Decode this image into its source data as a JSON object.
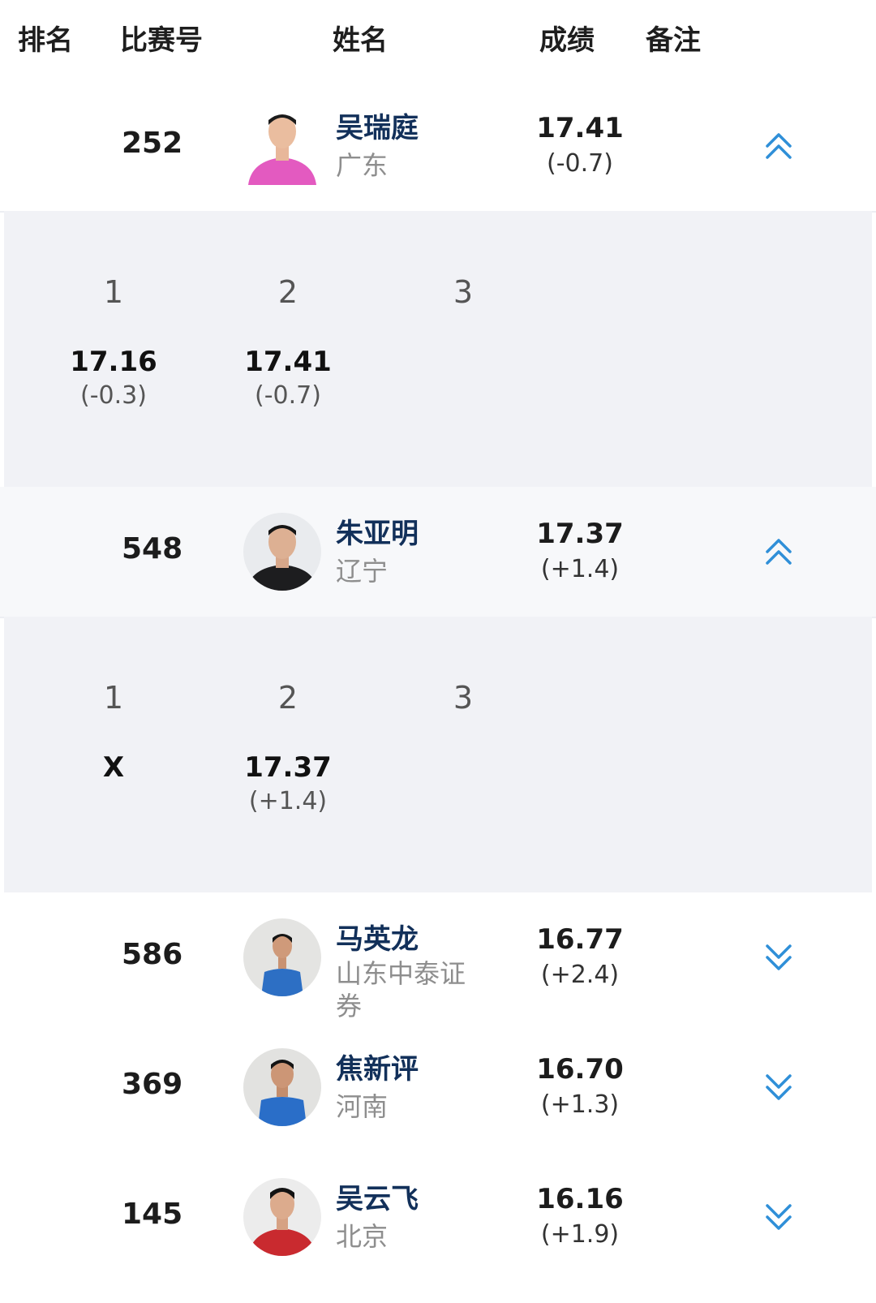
{
  "header": {
    "rank": "排名",
    "bib": "比赛号",
    "name": "姓名",
    "score": "成绩",
    "note": "备注"
  },
  "attempt_headers": [
    "1",
    "2",
    "3"
  ],
  "athletes": [
    {
      "bib": "252",
      "name": "吴瑞庭",
      "team": "广东",
      "score": "17.41",
      "wind": "(-0.7)",
      "expanded": true,
      "attempts": [
        {
          "value": "17.16",
          "wind": "(-0.3)"
        },
        {
          "value": "17.41",
          "wind": "(-0.7)"
        }
      ]
    },
    {
      "bib": "548",
      "name": "朱亚明",
      "team": "辽宁",
      "score": "17.37",
      "wind": "(+1.4)",
      "expanded": true,
      "attempts": [
        {
          "value": "X",
          "wind": ""
        },
        {
          "value": "17.37",
          "wind": "(+1.4)"
        }
      ]
    },
    {
      "bib": "586",
      "name": "马英龙",
      "team": "山东中泰证券",
      "score": "16.77",
      "wind": "(+2.4)",
      "expanded": false
    },
    {
      "bib": "369",
      "name": "焦新评",
      "team": "河南",
      "score": "16.70",
      "wind": "(+1.3)",
      "expanded": false
    },
    {
      "bib": "145",
      "name": "吴云飞",
      "team": "北京",
      "score": "16.16",
      "wind": "(+1.9)",
      "expanded": false
    }
  ],
  "icons": {
    "expanded": "chevron-double-up-icon",
    "collapsed": "chevron-double-down-icon"
  },
  "colors": {
    "accent": "#2f8fd8",
    "name": "#12305a",
    "panel": "#f1f2f6"
  }
}
